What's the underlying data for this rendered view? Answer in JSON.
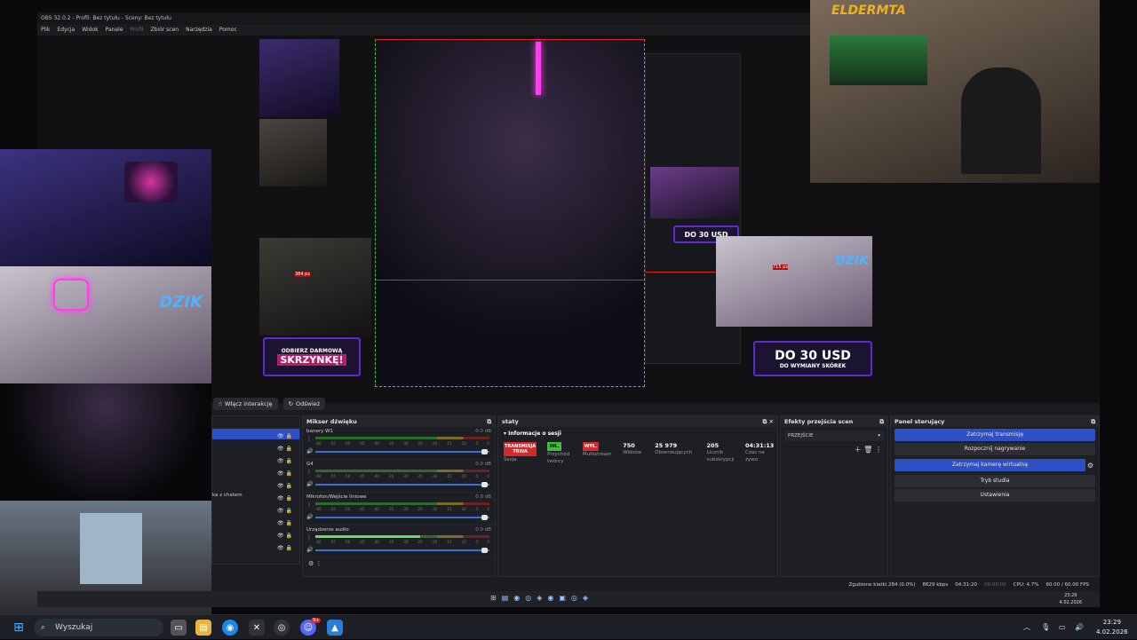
{
  "window": {
    "title": "OBS 32.0.2 - Profil: Bez tytułu - Sceny: Bez tytułu",
    "menu": [
      "Plik",
      "Edycja",
      "Widok",
      "Panele",
      "Profil",
      "Zbiór scen",
      "Narzędzia",
      "Pomoc"
    ]
  },
  "overlay": {
    "streamer_logo": "ELDERMTA",
    "dzik_logo": "DZIK",
    "ad_promo_line1": "ODBIERZ DARMOWĄ",
    "ad_promo_line2": "SKRZYNKĘ!",
    "ad_usd_big": "DO 30 USD",
    "ad_usd_small": "DO WYMIANY SKÓREK",
    "px_label_left": "384 px",
    "px_label_right": "715 px"
  },
  "toolbar": {
    "interact_label": "Włącz interakcję",
    "refresh_label": "Odśwież"
  },
  "sources": {
    "chat_label": "ka z chatem"
  },
  "mixer": {
    "title": "Mikser dźwięku",
    "scale": [
      "-60",
      "-55",
      "-50",
      "-45",
      "-40",
      "-35",
      "-30",
      "-25",
      "-20",
      "-15",
      "-10",
      "-5",
      "0"
    ],
    "channels": [
      {
        "name": "banery W1",
        "db": "0.0 dB",
        "level": 0.0
      },
      {
        "name": "G4",
        "db": "0.0 dB",
        "level": 0.0
      },
      {
        "name": "Mikrofon/Wejście liniowe",
        "db": "0.0 dB",
        "level": 0.0
      },
      {
        "name": "Urządzenie audio",
        "db": "0.0 dB",
        "level": 0.6
      }
    ]
  },
  "stats": {
    "title": "staty",
    "section": "Informacje o sesji",
    "status_live": "TRANSMISJA TRWA",
    "status_live_label": "Sesja",
    "badge_on": "WŁ.",
    "badge_on_label": "Przychód twórcy",
    "badge_off": "WYŁ.",
    "badge_off_label": "Multistream",
    "viewers": "750",
    "viewers_label": "Widzów",
    "followers": "25 979",
    "followers_label": "Obserwujących",
    "subs": "205",
    "subs_label": "Licznik subskrypcji",
    "uptime": "04:31:13",
    "uptime_label": "Czas na żywo"
  },
  "transitions": {
    "title": "Efekty przejścia scen",
    "selected": "PRZEJŚCIE"
  },
  "controls": {
    "title": "Panel sterujący",
    "stop_stream": "Zatrzymaj transmisję",
    "start_record": "Rozpocznij nagrywanie",
    "stop_vcam": "Zatrzymaj kamerę wirtualną",
    "studio": "Tryb studia",
    "settings": "Ustawienia"
  },
  "statusbar": {
    "dropped": "Zgubione klatki 284 (0.0%)",
    "bitrate": "8629 kbps",
    "stream_time": "04:31:20",
    "rec_time": "00:00:00",
    "cpu": "CPU: 4.7%",
    "fps": "60.00 / 60.00 FPS",
    "clock": "23:29",
    "date": "4.02.2026"
  },
  "taskbar": {
    "search_placeholder": "Wyszukaj",
    "time": "23:29",
    "date": "4.02.2026",
    "discord_badge": "9+"
  },
  "colors": {
    "accent_blue": "#2f4fc4",
    "live_red": "#d42a2a",
    "on_green": "#3bbf3b",
    "ad_purple": "#5f2bd1"
  }
}
